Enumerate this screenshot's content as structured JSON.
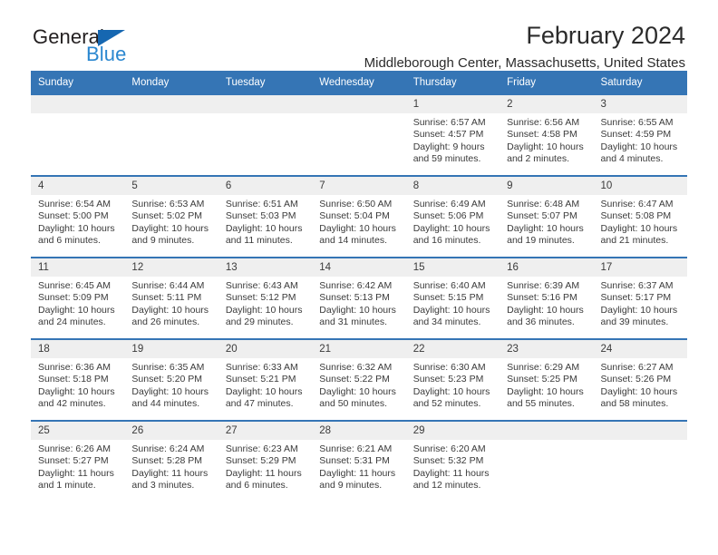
{
  "brand": {
    "name_part1": "General",
    "name_part2": "Blue",
    "triangle_color": "#1667b1",
    "blue_text_color": "#2a87d0"
  },
  "header": {
    "title": "February 2024",
    "subtitle": "Middleborough Center, Massachusetts, United States",
    "accent_color": "#3575b5",
    "band_color": "#efefef"
  },
  "weekdays": [
    "Sunday",
    "Monday",
    "Tuesday",
    "Wednesday",
    "Thursday",
    "Friday",
    "Saturday"
  ],
  "weeks": [
    [
      {
        "day": "",
        "lines": []
      },
      {
        "day": "",
        "lines": []
      },
      {
        "day": "",
        "lines": []
      },
      {
        "day": "",
        "lines": []
      },
      {
        "day": "1",
        "lines": [
          "Sunrise: 6:57 AM",
          "Sunset: 4:57 PM",
          "Daylight: 9 hours",
          "and 59 minutes."
        ]
      },
      {
        "day": "2",
        "lines": [
          "Sunrise: 6:56 AM",
          "Sunset: 4:58 PM",
          "Daylight: 10 hours",
          "and 2 minutes."
        ]
      },
      {
        "day": "3",
        "lines": [
          "Sunrise: 6:55 AM",
          "Sunset: 4:59 PM",
          "Daylight: 10 hours",
          "and 4 minutes."
        ]
      }
    ],
    [
      {
        "day": "4",
        "lines": [
          "Sunrise: 6:54 AM",
          "Sunset: 5:00 PM",
          "Daylight: 10 hours",
          "and 6 minutes."
        ]
      },
      {
        "day": "5",
        "lines": [
          "Sunrise: 6:53 AM",
          "Sunset: 5:02 PM",
          "Daylight: 10 hours",
          "and 9 minutes."
        ]
      },
      {
        "day": "6",
        "lines": [
          "Sunrise: 6:51 AM",
          "Sunset: 5:03 PM",
          "Daylight: 10 hours",
          "and 11 minutes."
        ]
      },
      {
        "day": "7",
        "lines": [
          "Sunrise: 6:50 AM",
          "Sunset: 5:04 PM",
          "Daylight: 10 hours",
          "and 14 minutes."
        ]
      },
      {
        "day": "8",
        "lines": [
          "Sunrise: 6:49 AM",
          "Sunset: 5:06 PM",
          "Daylight: 10 hours",
          "and 16 minutes."
        ]
      },
      {
        "day": "9",
        "lines": [
          "Sunrise: 6:48 AM",
          "Sunset: 5:07 PM",
          "Daylight: 10 hours",
          "and 19 minutes."
        ]
      },
      {
        "day": "10",
        "lines": [
          "Sunrise: 6:47 AM",
          "Sunset: 5:08 PM",
          "Daylight: 10 hours",
          "and 21 minutes."
        ]
      }
    ],
    [
      {
        "day": "11",
        "lines": [
          "Sunrise: 6:45 AM",
          "Sunset: 5:09 PM",
          "Daylight: 10 hours",
          "and 24 minutes."
        ]
      },
      {
        "day": "12",
        "lines": [
          "Sunrise: 6:44 AM",
          "Sunset: 5:11 PM",
          "Daylight: 10 hours",
          "and 26 minutes."
        ]
      },
      {
        "day": "13",
        "lines": [
          "Sunrise: 6:43 AM",
          "Sunset: 5:12 PM",
          "Daylight: 10 hours",
          "and 29 minutes."
        ]
      },
      {
        "day": "14",
        "lines": [
          "Sunrise: 6:42 AM",
          "Sunset: 5:13 PM",
          "Daylight: 10 hours",
          "and 31 minutes."
        ]
      },
      {
        "day": "15",
        "lines": [
          "Sunrise: 6:40 AM",
          "Sunset: 5:15 PM",
          "Daylight: 10 hours",
          "and 34 minutes."
        ]
      },
      {
        "day": "16",
        "lines": [
          "Sunrise: 6:39 AM",
          "Sunset: 5:16 PM",
          "Daylight: 10 hours",
          "and 36 minutes."
        ]
      },
      {
        "day": "17",
        "lines": [
          "Sunrise: 6:37 AM",
          "Sunset: 5:17 PM",
          "Daylight: 10 hours",
          "and 39 minutes."
        ]
      }
    ],
    [
      {
        "day": "18",
        "lines": [
          "Sunrise: 6:36 AM",
          "Sunset: 5:18 PM",
          "Daylight: 10 hours",
          "and 42 minutes."
        ]
      },
      {
        "day": "19",
        "lines": [
          "Sunrise: 6:35 AM",
          "Sunset: 5:20 PM",
          "Daylight: 10 hours",
          "and 44 minutes."
        ]
      },
      {
        "day": "20",
        "lines": [
          "Sunrise: 6:33 AM",
          "Sunset: 5:21 PM",
          "Daylight: 10 hours",
          "and 47 minutes."
        ]
      },
      {
        "day": "21",
        "lines": [
          "Sunrise: 6:32 AM",
          "Sunset: 5:22 PM",
          "Daylight: 10 hours",
          "and 50 minutes."
        ]
      },
      {
        "day": "22",
        "lines": [
          "Sunrise: 6:30 AM",
          "Sunset: 5:23 PM",
          "Daylight: 10 hours",
          "and 52 minutes."
        ]
      },
      {
        "day": "23",
        "lines": [
          "Sunrise: 6:29 AM",
          "Sunset: 5:25 PM",
          "Daylight: 10 hours",
          "and 55 minutes."
        ]
      },
      {
        "day": "24",
        "lines": [
          "Sunrise: 6:27 AM",
          "Sunset: 5:26 PM",
          "Daylight: 10 hours",
          "and 58 minutes."
        ]
      }
    ],
    [
      {
        "day": "25",
        "lines": [
          "Sunrise: 6:26 AM",
          "Sunset: 5:27 PM",
          "Daylight: 11 hours",
          "and 1 minute."
        ]
      },
      {
        "day": "26",
        "lines": [
          "Sunrise: 6:24 AM",
          "Sunset: 5:28 PM",
          "Daylight: 11 hours",
          "and 3 minutes."
        ]
      },
      {
        "day": "27",
        "lines": [
          "Sunrise: 6:23 AM",
          "Sunset: 5:29 PM",
          "Daylight: 11 hours",
          "and 6 minutes."
        ]
      },
      {
        "day": "28",
        "lines": [
          "Sunrise: 6:21 AM",
          "Sunset: 5:31 PM",
          "Daylight: 11 hours",
          "and 9 minutes."
        ]
      },
      {
        "day": "29",
        "lines": [
          "Sunrise: 6:20 AM",
          "Sunset: 5:32 PM",
          "Daylight: 11 hours",
          "and 12 minutes."
        ]
      },
      {
        "day": "",
        "lines": []
      },
      {
        "day": "",
        "lines": []
      }
    ]
  ]
}
